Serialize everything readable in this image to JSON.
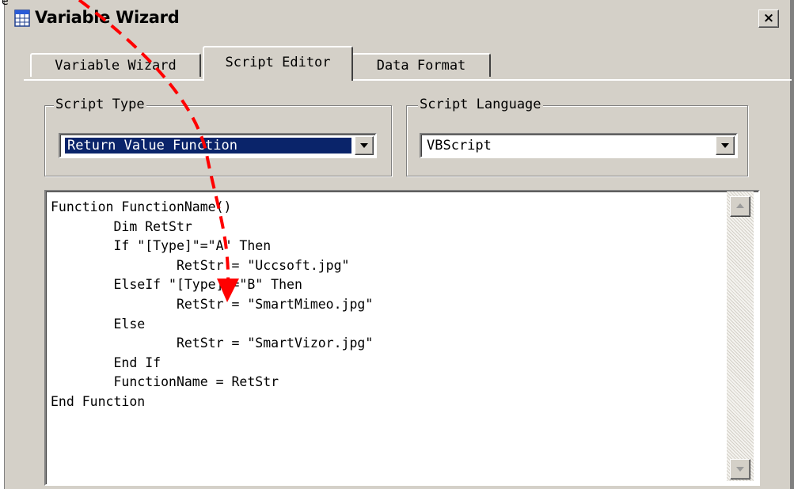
{
  "window": {
    "title": "Variable Wizard",
    "close_label": "×",
    "icon": "table-grid-icon"
  },
  "tabs": [
    {
      "label": "Variable Wizard",
      "active": false
    },
    {
      "label": "Script Editor",
      "active": true
    },
    {
      "label": "Data Format",
      "active": false
    }
  ],
  "script_type": {
    "legend": "Script Type",
    "selected": "Return Value Function"
  },
  "script_language": {
    "legend": "Script Language",
    "selected": "VBScript"
  },
  "editor": {
    "code": "Function FunctionName()\n        Dim RetStr\n        If \"[Type]\"=\"A\" Then\n                RetStr = \"Uccsoft.jpg\"\n        ElseIf \"[Type]\"=\"B\" Then\n                RetStr = \"SmartMimeo.jpg\"\n        Else\n                RetStr = \"SmartVizor.jpg\"\n        End If\n        FunctionName = RetStr\nEnd Function"
  },
  "annotation": {
    "color": "#ff0000",
    "style": "dashed-arrow",
    "corner_text": "e"
  },
  "colors": {
    "face": "#d4d0c8",
    "selection": "#0a246a"
  }
}
